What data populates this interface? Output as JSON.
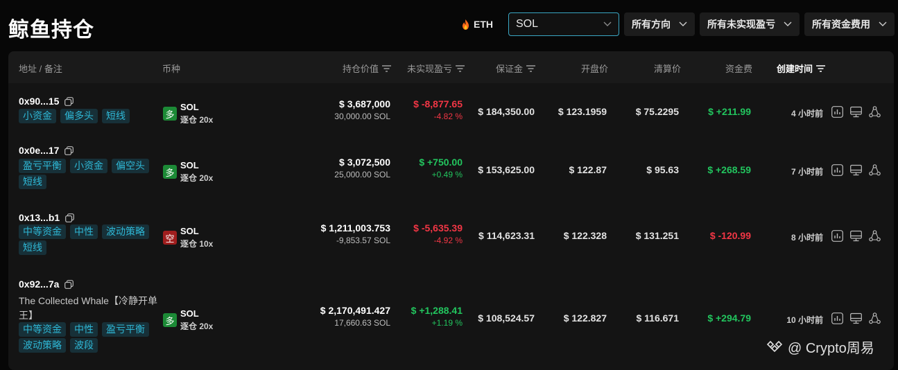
{
  "header": {
    "title": "鲸鱼持仓",
    "eth_label": "ETH",
    "coin_select": "SOL",
    "direction_select": "所有方向",
    "pnl_select": "所有未实现盈亏",
    "funding_select": "所有资金费用"
  },
  "columns": {
    "address": "地址 / 备注",
    "coin": "币种",
    "value": "持仓价值",
    "pnl": "未实现盈亏",
    "margin": "保证金",
    "entry": "开盘价",
    "liq": "清算价",
    "funding": "资金费",
    "created": "创建时间"
  },
  "rows": [
    {
      "address": "0x90...15",
      "note": "",
      "tags": [
        "小资金",
        "偏多头",
        "短线"
      ],
      "side": "多",
      "coin": "SOL",
      "leverage": "逐仓 20x",
      "value": "$ 3,687,000",
      "size": "30,000.00 SOL",
      "pnl": "$ -8,877.65",
      "pnl_pct": "-4.82 %",
      "margin": "$ 184,350.00",
      "entry": "$ 123.1959",
      "liq": "$ 75.2295",
      "funding": "$ +211.99",
      "time": "4 小时前"
    },
    {
      "address": "0x0e...17",
      "note": "",
      "tags": [
        "盈亏平衡",
        "小资金",
        "偏空头",
        "短线"
      ],
      "side": "多",
      "coin": "SOL",
      "leverage": "逐仓 20x",
      "value": "$ 3,072,500",
      "size": "25,000.00 SOL",
      "pnl": "$ +750.00",
      "pnl_pct": "+0.49 %",
      "margin": "$ 153,625.00",
      "entry": "$ 122.87",
      "liq": "$ 95.63",
      "funding": "$ +268.59",
      "time": "7 小时前"
    },
    {
      "address": "0x13...b1",
      "note": "",
      "tags": [
        "中等资金",
        "中性",
        "波动策略",
        "短线"
      ],
      "side": "空",
      "coin": "SOL",
      "leverage": "逐仓 10x",
      "value": "$ 1,211,003.753",
      "size": "-9,853.57 SOL",
      "pnl": "$ -5,635.39",
      "pnl_pct": "-4.92 %",
      "margin": "$ 114,623.31",
      "entry": "$ 122.328",
      "liq": "$ 131.251",
      "funding": "$ -120.99",
      "time": "8 小时前"
    },
    {
      "address": "0x92...7a",
      "note": "The Collected Whale【冷静开单王】",
      "tags": [
        "中等资金",
        "中性",
        "盈亏平衡",
        "波动策略",
        "波段"
      ],
      "side": "多",
      "coin": "SOL",
      "leverage": "逐仓 20x",
      "value": "$ 2,170,491.427",
      "size": "17,660.63 SOL",
      "pnl": "$ +1,288.41",
      "pnl_pct": "+1.19 %",
      "margin": "$ 108,524.57",
      "entry": "$ 122.827",
      "liq": "$ 116.671",
      "funding": "$ +294.79",
      "time": "10 小时前"
    }
  ],
  "watermark": "@ Crypto周易"
}
